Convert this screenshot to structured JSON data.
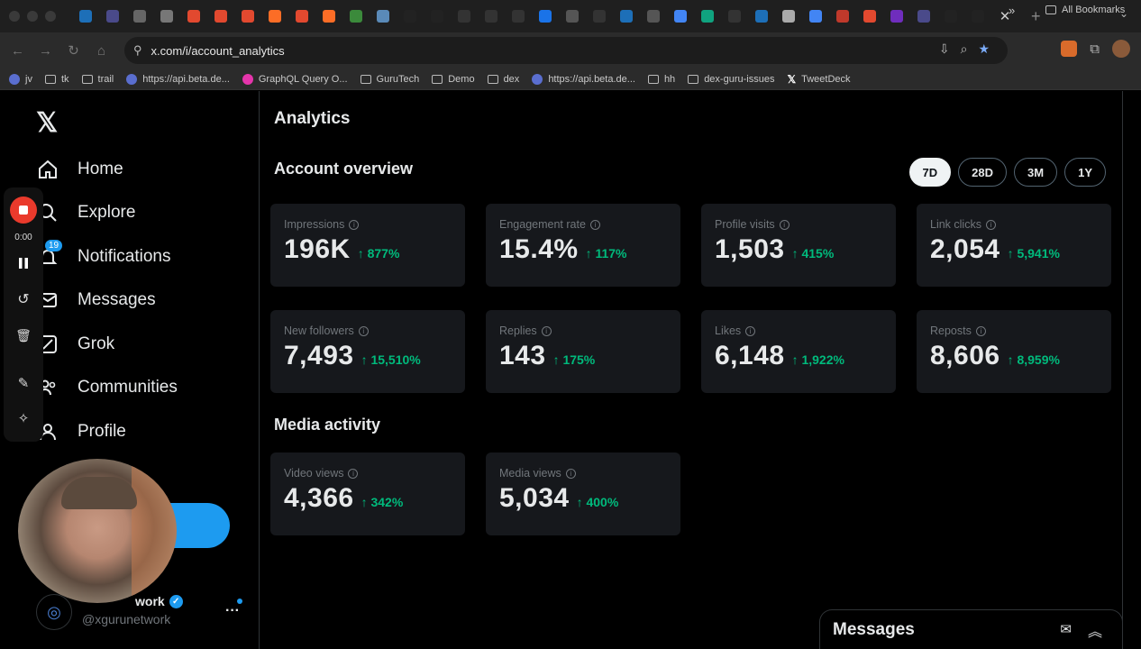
{
  "browser": {
    "url": "x.com/i/account_analytics",
    "bookmarks": [
      "jv",
      "tk",
      "trail",
      "https://api.beta.de...",
      "GraphQL Query O...",
      "GuruTech",
      "Demo",
      "dex",
      "https://api.beta.de...",
      "hh",
      "dex-guru-issues",
      "TweetDeck"
    ],
    "all_bookmarks": "All Bookmarks",
    "tab_icon_colors": [
      "#1d6fb8",
      "#4a4a8a",
      "#666",
      "#777",
      "#e2492f",
      "#e2492f",
      "#e2492f",
      "#fc6d26",
      "#e2492f",
      "#fc6d26",
      "#3b8a3b",
      "#5a8ab8",
      "#222",
      "#222",
      "#333",
      "#333",
      "#333",
      "#1a73e8",
      "#555",
      "#333",
      "#1d6fb8",
      "#555",
      "#4285f4",
      "#10a37f",
      "#333",
      "#1d6fb8",
      "#aaa",
      "#4285f4",
      "#c0392b",
      "#e2492f",
      "#6f2dbd",
      "#4a4a8a",
      "#222",
      "#222"
    ]
  },
  "nav": {
    "home": "Home",
    "explore": "Explore",
    "notifications": "Notifications",
    "notifications_badge": "19",
    "messages": "Messages",
    "grok": "Grok",
    "communities": "Communities",
    "profile": "Profile"
  },
  "recorder": {
    "time": "0:00"
  },
  "account": {
    "name": "work",
    "handle": "@xgurunetwork"
  },
  "page": {
    "title": "Analytics",
    "overview_title": "Account overview",
    "media_title": "Media activity",
    "ranges": [
      "7D",
      "28D",
      "3M",
      "1Y"
    ],
    "active_range": "7D"
  },
  "overview_cards": [
    {
      "label": "Impressions",
      "value": "196K",
      "change": "↑ 877%"
    },
    {
      "label": "Engagement rate",
      "value": "15.4%",
      "change": "↑ 117%"
    },
    {
      "label": "Profile visits",
      "value": "1,503",
      "change": "↑ 415%"
    },
    {
      "label": "Link clicks",
      "value": "2,054",
      "change": "↑ 5,941%"
    },
    {
      "label": "New followers",
      "value": "7,493",
      "change": "↑ 15,510%"
    },
    {
      "label": "Replies",
      "value": "143",
      "change": "↑ 175%"
    },
    {
      "label": "Likes",
      "value": "6,148",
      "change": "↑ 1,922%"
    },
    {
      "label": "Reposts",
      "value": "8,606",
      "change": "↑ 8,959%"
    }
  ],
  "media_cards": [
    {
      "label": "Video views",
      "value": "4,366",
      "change": "↑ 342%"
    },
    {
      "label": "Media views",
      "value": "5,034",
      "change": "↑ 400%"
    }
  ],
  "messages_drawer": {
    "title": "Messages"
  },
  "colors": {
    "accent": "#1d9bf0",
    "positive": "#00ba7c",
    "card_bg": "#16181c"
  }
}
